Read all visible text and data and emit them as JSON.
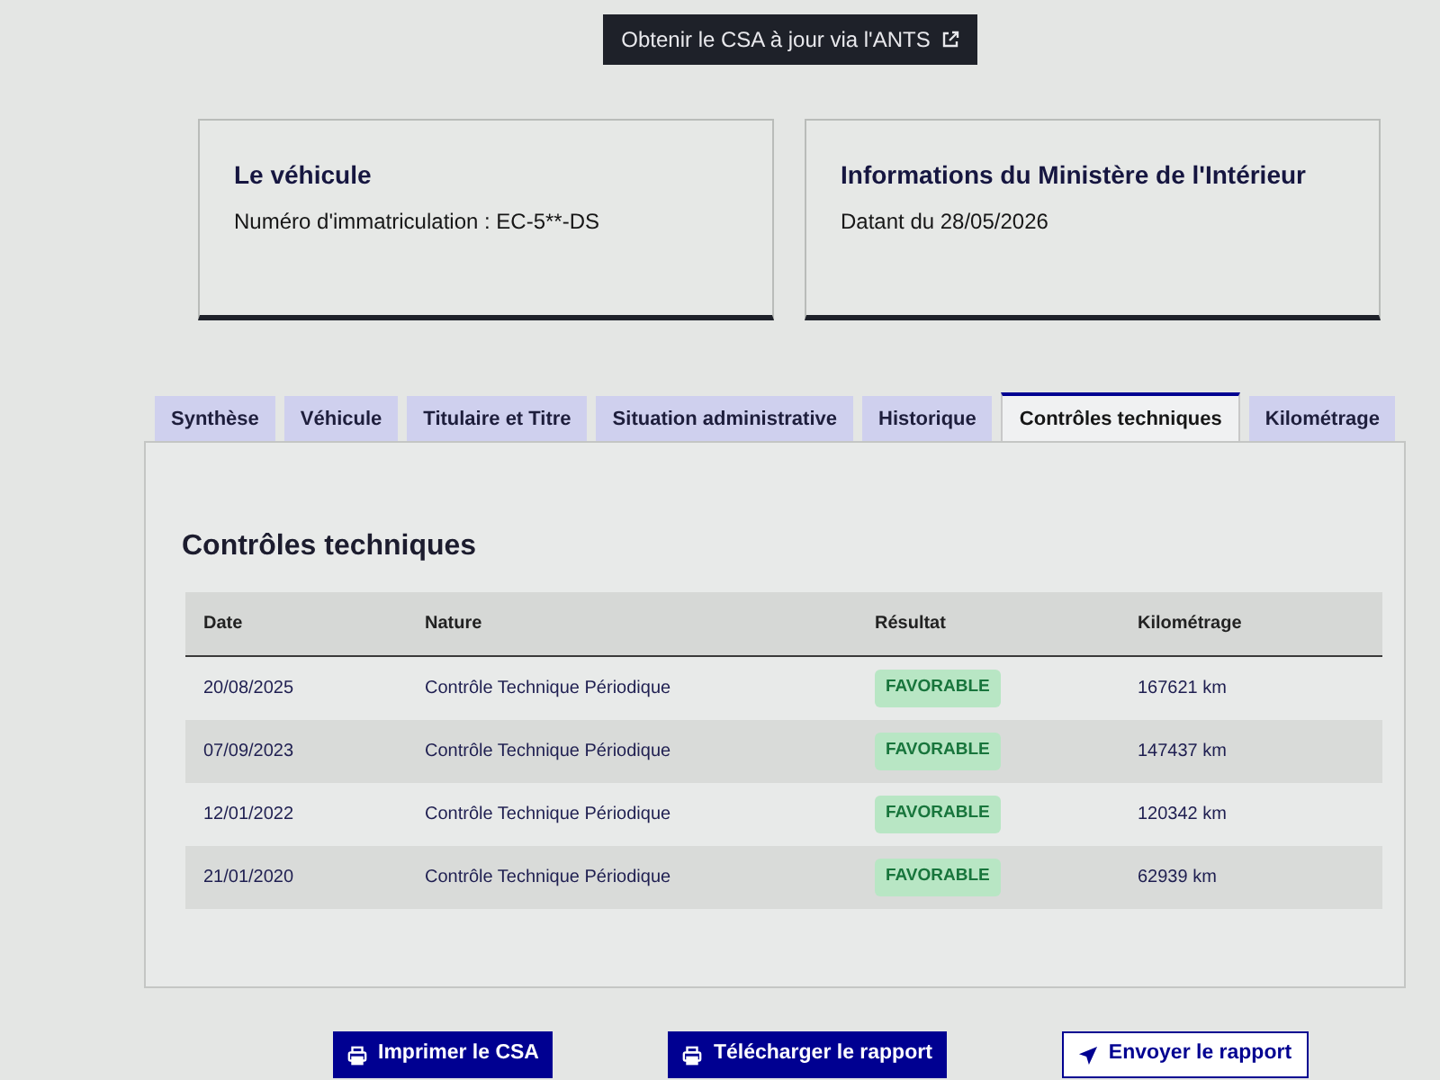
{
  "top_button": {
    "label": "Obtenir le CSA à jour via l'ANTS"
  },
  "cards": [
    {
      "title": "Le véhicule",
      "text": "Numéro d'immatriculation : EC-5**-DS"
    },
    {
      "title": "Informations du Ministère de l'Intérieur",
      "text": "Datant du 28/05/2026"
    }
  ],
  "tabs": [
    {
      "label": "Synthèse",
      "selected": false
    },
    {
      "label": "Véhicule",
      "selected": false
    },
    {
      "label": "Titulaire et Titre",
      "selected": false
    },
    {
      "label": "Situation administrative",
      "selected": false
    },
    {
      "label": "Historique",
      "selected": false
    },
    {
      "label": "Contrôles techniques",
      "selected": true
    },
    {
      "label": "Kilométrage",
      "selected": false
    }
  ],
  "panel": {
    "title": "Contrôles techniques",
    "table": {
      "columns": [
        "Date",
        "Nature",
        "Résultat",
        "Kilométrage"
      ],
      "rows": [
        {
          "date": "20/08/2025",
          "nature": "Contrôle Technique Périodique",
          "result": "FAVORABLE",
          "mileage": "167621 km"
        },
        {
          "date": "07/09/2023",
          "nature": "Contrôle Technique Périodique",
          "result": "FAVORABLE",
          "mileage": "147437 km"
        },
        {
          "date": "12/01/2022",
          "nature": "Contrôle Technique Périodique",
          "result": "FAVORABLE",
          "mileage": "120342 km"
        },
        {
          "date": "21/01/2020",
          "nature": "Contrôle Technique Périodique",
          "result": "FAVORABLE",
          "mileage": "62939 km"
        }
      ]
    }
  },
  "actions": [
    {
      "label": "Imprimer le CSA",
      "kind": "primary"
    },
    {
      "label": "Télécharger le rapport",
      "kind": "primary"
    },
    {
      "label": "Envoyer le rapport",
      "kind": "secondary"
    }
  ]
}
